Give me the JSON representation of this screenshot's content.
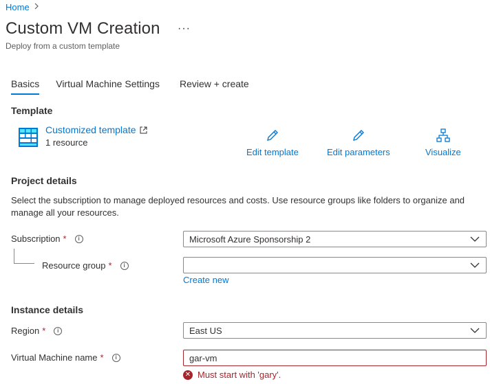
{
  "breadcrumb": {
    "home": "Home",
    "separator": ">"
  },
  "header": {
    "title": "Custom VM Creation",
    "more": "···",
    "subtitle": "Deploy from a custom template"
  },
  "tabs": [
    {
      "label": "Basics",
      "active": true
    },
    {
      "label": "Virtual Machine Settings",
      "active": false
    },
    {
      "label": "Review + create",
      "active": false
    }
  ],
  "template": {
    "section_title": "Template",
    "name": "Customized template",
    "resource_count": "1 resource",
    "actions": {
      "edit_template": "Edit template",
      "edit_parameters": "Edit parameters",
      "visualize": "Visualize"
    }
  },
  "project": {
    "section_title": "Project details",
    "description": "Select the subscription to manage deployed resources and costs. Use resource groups like folders to organize and manage all your resources.",
    "subscription_label": "Subscription",
    "subscription_value": "Microsoft Azure Sponsorship 2",
    "resource_group_label": "Resource group",
    "resource_group_value": "",
    "create_new": "Create new"
  },
  "instance": {
    "section_title": "Instance details",
    "region_label": "Region",
    "region_value": "East US",
    "vm_name_label": "Virtual Machine name",
    "vm_name_value": "gar-vm",
    "vm_name_error": "Must start with 'gary'."
  },
  "common": {
    "required": "*",
    "info": "i"
  },
  "colors": {
    "accent": "#0078d4",
    "error": "#a4262c",
    "text": "#323130"
  }
}
